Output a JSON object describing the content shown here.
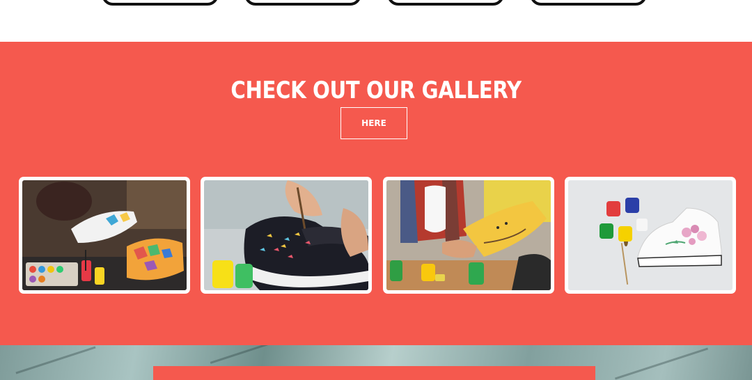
{
  "top": {
    "buttons": [
      "",
      "",
      "",
      ""
    ]
  },
  "gallery": {
    "title": "CHECK OUT OUR GALLERY",
    "button_label": "HERE",
    "images": [
      {
        "alt": "painting colorful geometric sneakers"
      },
      {
        "alt": "painting birds on black sneaker"
      },
      {
        "alt": "man painting yellow sneaker"
      },
      {
        "alt": "white high-top sneaker with pink flowers and paints"
      }
    ]
  },
  "colors": {
    "accent": "#f5594e",
    "text_light": "#ffffff",
    "outline": "#111111"
  }
}
